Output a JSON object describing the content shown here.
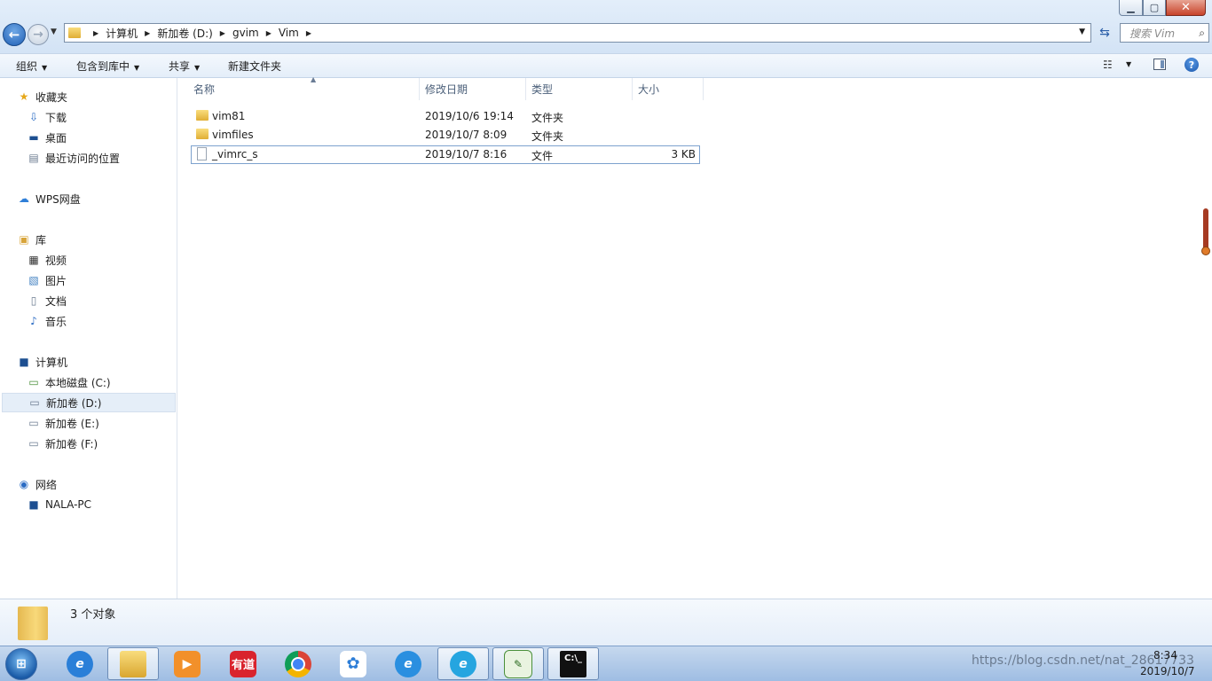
{
  "window": {
    "min_label": "▁",
    "max_label": "▢",
    "close_label": "✕"
  },
  "address": {
    "crumbs": [
      "计算机",
      "新加卷 (D:)",
      "gvim",
      "Vim"
    ],
    "search_placeholder": "搜索 Vim"
  },
  "toolbar": {
    "organize": "组织",
    "include_library": "包含到库中",
    "share": "共享",
    "new_folder": "新建文件夹"
  },
  "nav": {
    "favorites": "收藏夹",
    "downloads": "下载",
    "desktop": "桌面",
    "recent": "最近访问的位置",
    "wps": "WPS网盘",
    "libraries": "库",
    "videos": "视频",
    "pictures": "图片",
    "documents": "文档",
    "music": "音乐",
    "computer": "计算机",
    "drive_c": "本地磁盘 (C:)",
    "drive_d": "新加卷 (D:)",
    "drive_e": "新加卷 (E:)",
    "drive_f": "新加卷 (F:)",
    "network": "网络",
    "pc": "NALA-PC"
  },
  "columns": {
    "name": "名称",
    "date": "修改日期",
    "type": "类型",
    "size": "大小"
  },
  "files": [
    {
      "name": "vim81",
      "date": "2019/10/6 19:14",
      "type": "文件夹",
      "size": ""
    },
    {
      "name": "vimfiles",
      "date": "2019/10/7 8:09",
      "type": "文件夹",
      "size": ""
    },
    {
      "name": "_vimrc_s",
      "date": "2019/10/7 8:16",
      "type": "文件",
      "size": "3 KB"
    }
  ],
  "details": {
    "count": "3 个对象"
  },
  "taskbar": {
    "youdao": "有道",
    "tray_text": "https://blog.csdn.net/nat_28617733",
    "time": "8:34",
    "date": "2019/10/7"
  }
}
